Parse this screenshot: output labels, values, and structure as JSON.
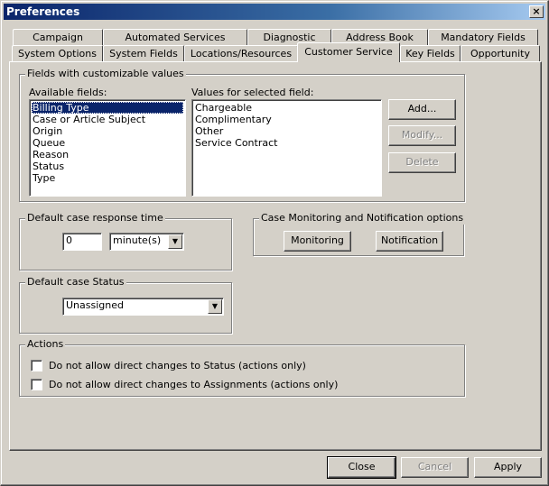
{
  "window": {
    "title": "Preferences",
    "close_glyph": "×"
  },
  "tabs_row1": [
    {
      "label": "Campaign"
    },
    {
      "label": "Automated Services"
    },
    {
      "label": "Diagnostic"
    },
    {
      "label": "Address Book"
    },
    {
      "label": "Mandatory Fields"
    }
  ],
  "tabs_row2": [
    {
      "label": "System Options"
    },
    {
      "label": "System Fields"
    },
    {
      "label": "Locations/Resources"
    },
    {
      "label": "Customer Service",
      "active": true
    },
    {
      "label": "Key Fields"
    },
    {
      "label": "Opportunity"
    }
  ],
  "fields_group": {
    "title": "Fields with customizable values",
    "available_label": "Available fields:",
    "available_fields": [
      "Billing Type",
      "Case or Article Subject",
      "Origin",
      "Queue",
      "Reason",
      "Status",
      "Type"
    ],
    "selected_index": 0,
    "values_label": "Values for selected field:",
    "values": [
      "Chargeable",
      "Complimentary",
      "Other",
      "Service Contract"
    ],
    "add_label": "Add...",
    "modify_label": "Modify...",
    "delete_label": "Delete"
  },
  "response_time": {
    "title": "Default case response time",
    "value": "0",
    "unit": "minute(s)"
  },
  "monitoring": {
    "title": "Case Monitoring and Notification options",
    "monitoring_label": "Monitoring",
    "notification_label": "Notification"
  },
  "case_status": {
    "title": "Default case Status",
    "value": "Unassigned"
  },
  "actions": {
    "title": "Actions",
    "status_checkbox_label": "Do not allow direct changes to Status (actions only)",
    "status_checked": false,
    "assignments_checkbox_label": "Do not allow direct changes to Assignments (actions only)",
    "assignments_checked": false
  },
  "footer": {
    "close_label": "Close",
    "cancel_label": "Cancel",
    "apply_label": "Apply"
  },
  "icons": {
    "dropdown_arrow": "▼"
  }
}
